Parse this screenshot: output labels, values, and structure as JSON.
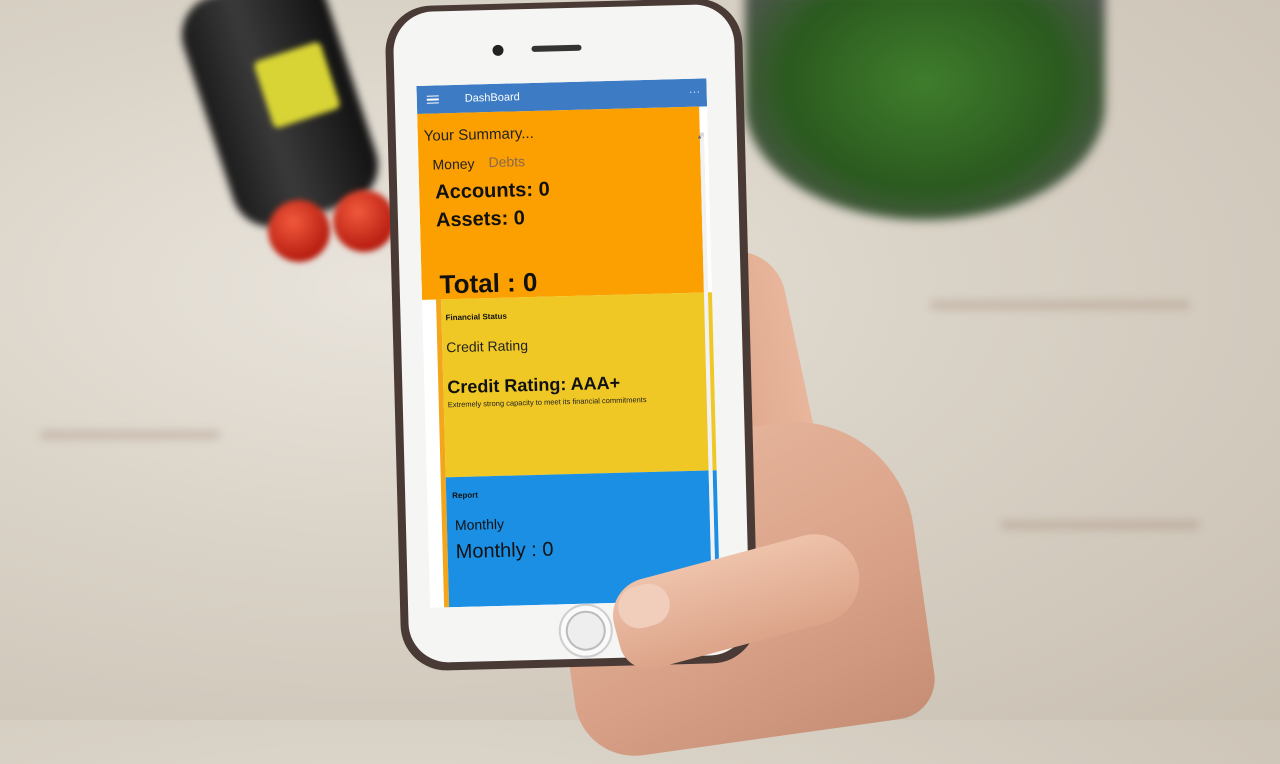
{
  "app": {
    "title": "DashBoard",
    "more_glyph": "..."
  },
  "summary": {
    "heading": "Your Summary...",
    "tabs": [
      "Money",
      "Debts"
    ],
    "accounts": "Accounts: 0",
    "assets": "Assets: 0",
    "total": "Total : 0"
  },
  "financial": {
    "label": "Financial Status",
    "tab": "Credit Rating",
    "rating": "Credit Rating: AAA+",
    "description": "Extremely strong capacity to meet its financial commitments"
  },
  "report": {
    "label": "Report",
    "tab": "Monthly",
    "monthly": "Monthly : 0"
  },
  "colors": {
    "topbar": "#3d7bc4",
    "summary": "#fba000",
    "financial": "#f0c825",
    "report": "#1b8fe4"
  },
  "icons": {
    "menu": "hamburger-menu-icon",
    "more": "more-options-icon",
    "scroll_up": "scroll-up-arrow-icon"
  }
}
